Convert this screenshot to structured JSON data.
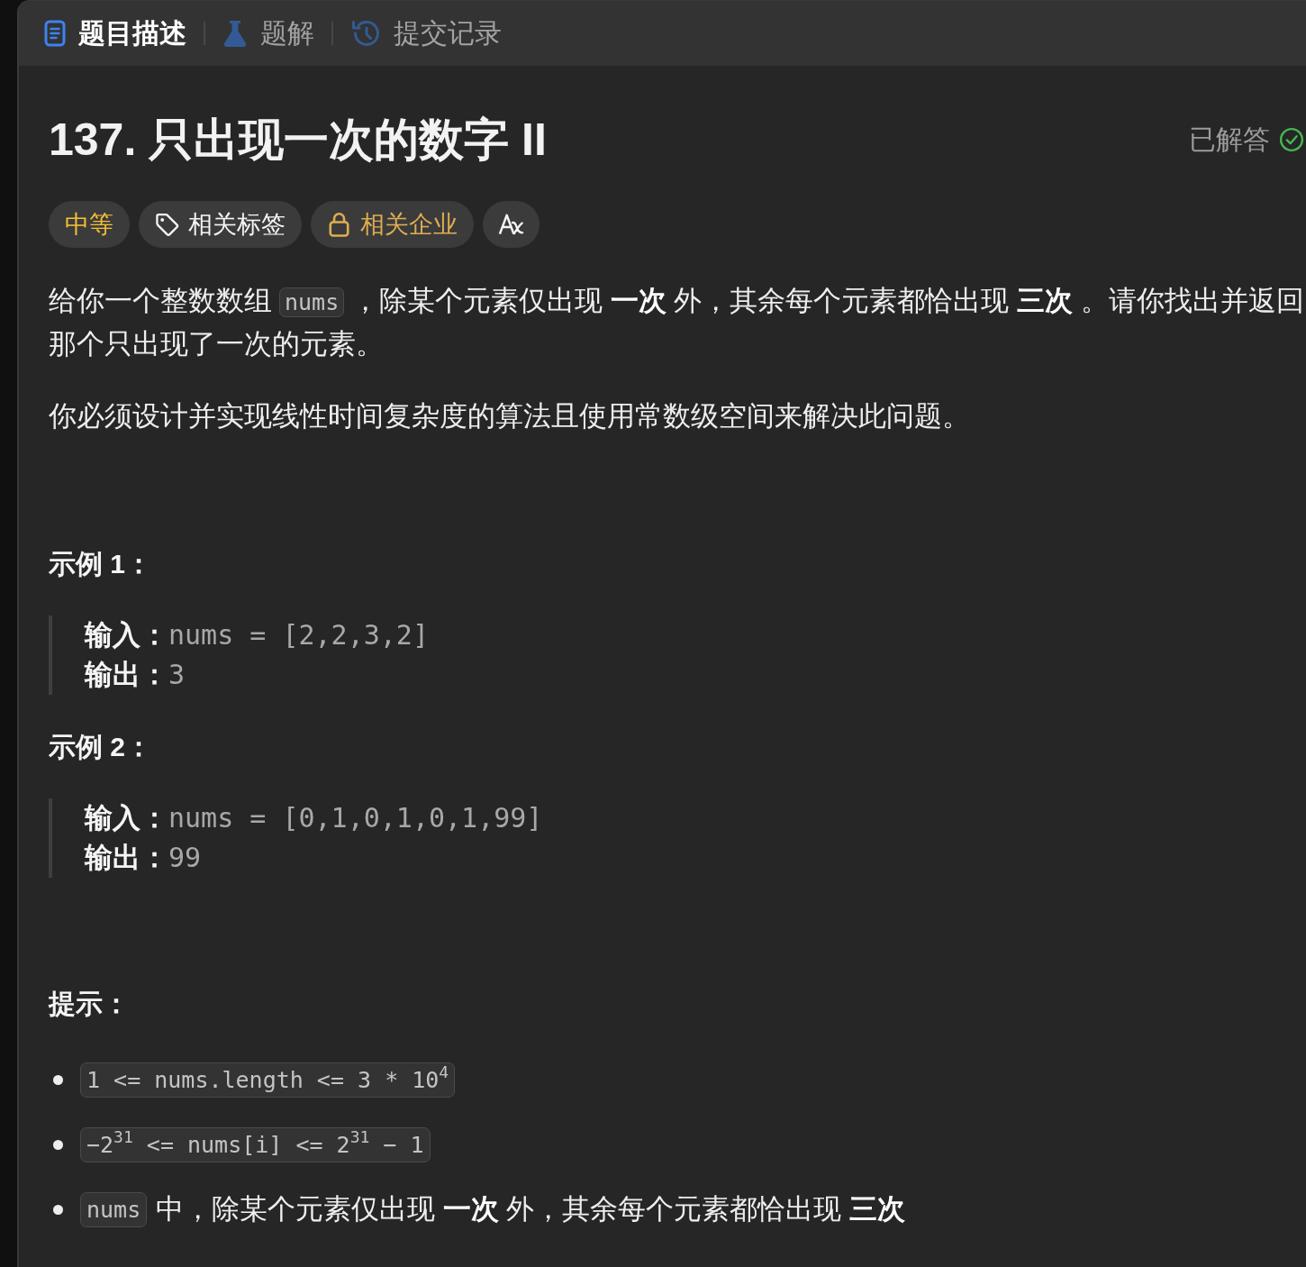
{
  "tabs": [
    {
      "label": "题目描述",
      "selected": true
    },
    {
      "label": "题解",
      "selected": false
    },
    {
      "label": "提交记录",
      "selected": false
    }
  ],
  "problem": {
    "title": "137. 只出现一次的数字 II",
    "status": "已解答"
  },
  "tags": [
    {
      "kind": "difficulty",
      "label": "中等"
    },
    {
      "kind": "topics",
      "label": "相关标签"
    },
    {
      "kind": "companies",
      "label": "相关企业"
    },
    {
      "kind": "translate"
    }
  ],
  "description": [
    [
      {
        "kind": "text",
        "text": "给你一个整数数组"
      },
      {
        "kind": "code",
        "text": "nums"
      },
      {
        "kind": "text",
        "text": "，除某个元素仅出现 **一次** 外，其余每个元素都恰出现 **三次** 。请你找出并返回那个只出现了一次的元素。"
      }
    ],
    [
      {
        "kind": "text",
        "text": "你必须设计并实现线性时间复杂度的算法且使用常数级空间来解决此问题。"
      }
    ]
  ],
  "examples": [
    {
      "title": "示例 1：",
      "lines": [
        {
          "label": "输入：",
          "value": "nums = [2,2,3,2]"
        },
        {
          "label": "输出：",
          "value": "3"
        }
      ]
    },
    {
      "title": "示例 2：",
      "lines": [
        {
          "label": "输入：",
          "value": "nums = [0,1,0,1,0,1,99]"
        },
        {
          "label": "输出：",
          "value": "99"
        }
      ]
    }
  ],
  "constraints": {
    "title": "提示：",
    "items": [
      [
        {
          "kind": "code",
          "text": "1 <= nums.length <= 3 * 10$^{4}$"
        }
      ],
      [
        {
          "kind": "code",
          "text": "−2$^{31}$ <= nums[i] <= 2$^{31}$ − 1"
        }
      ],
      [
        {
          "kind": "code",
          "text": "nums"
        },
        {
          "kind": "text",
          "text": "中，除某个元素仅出现 **一次** 外，其余每个元素都恰出现 **三次**"
        }
      ]
    ]
  }
}
